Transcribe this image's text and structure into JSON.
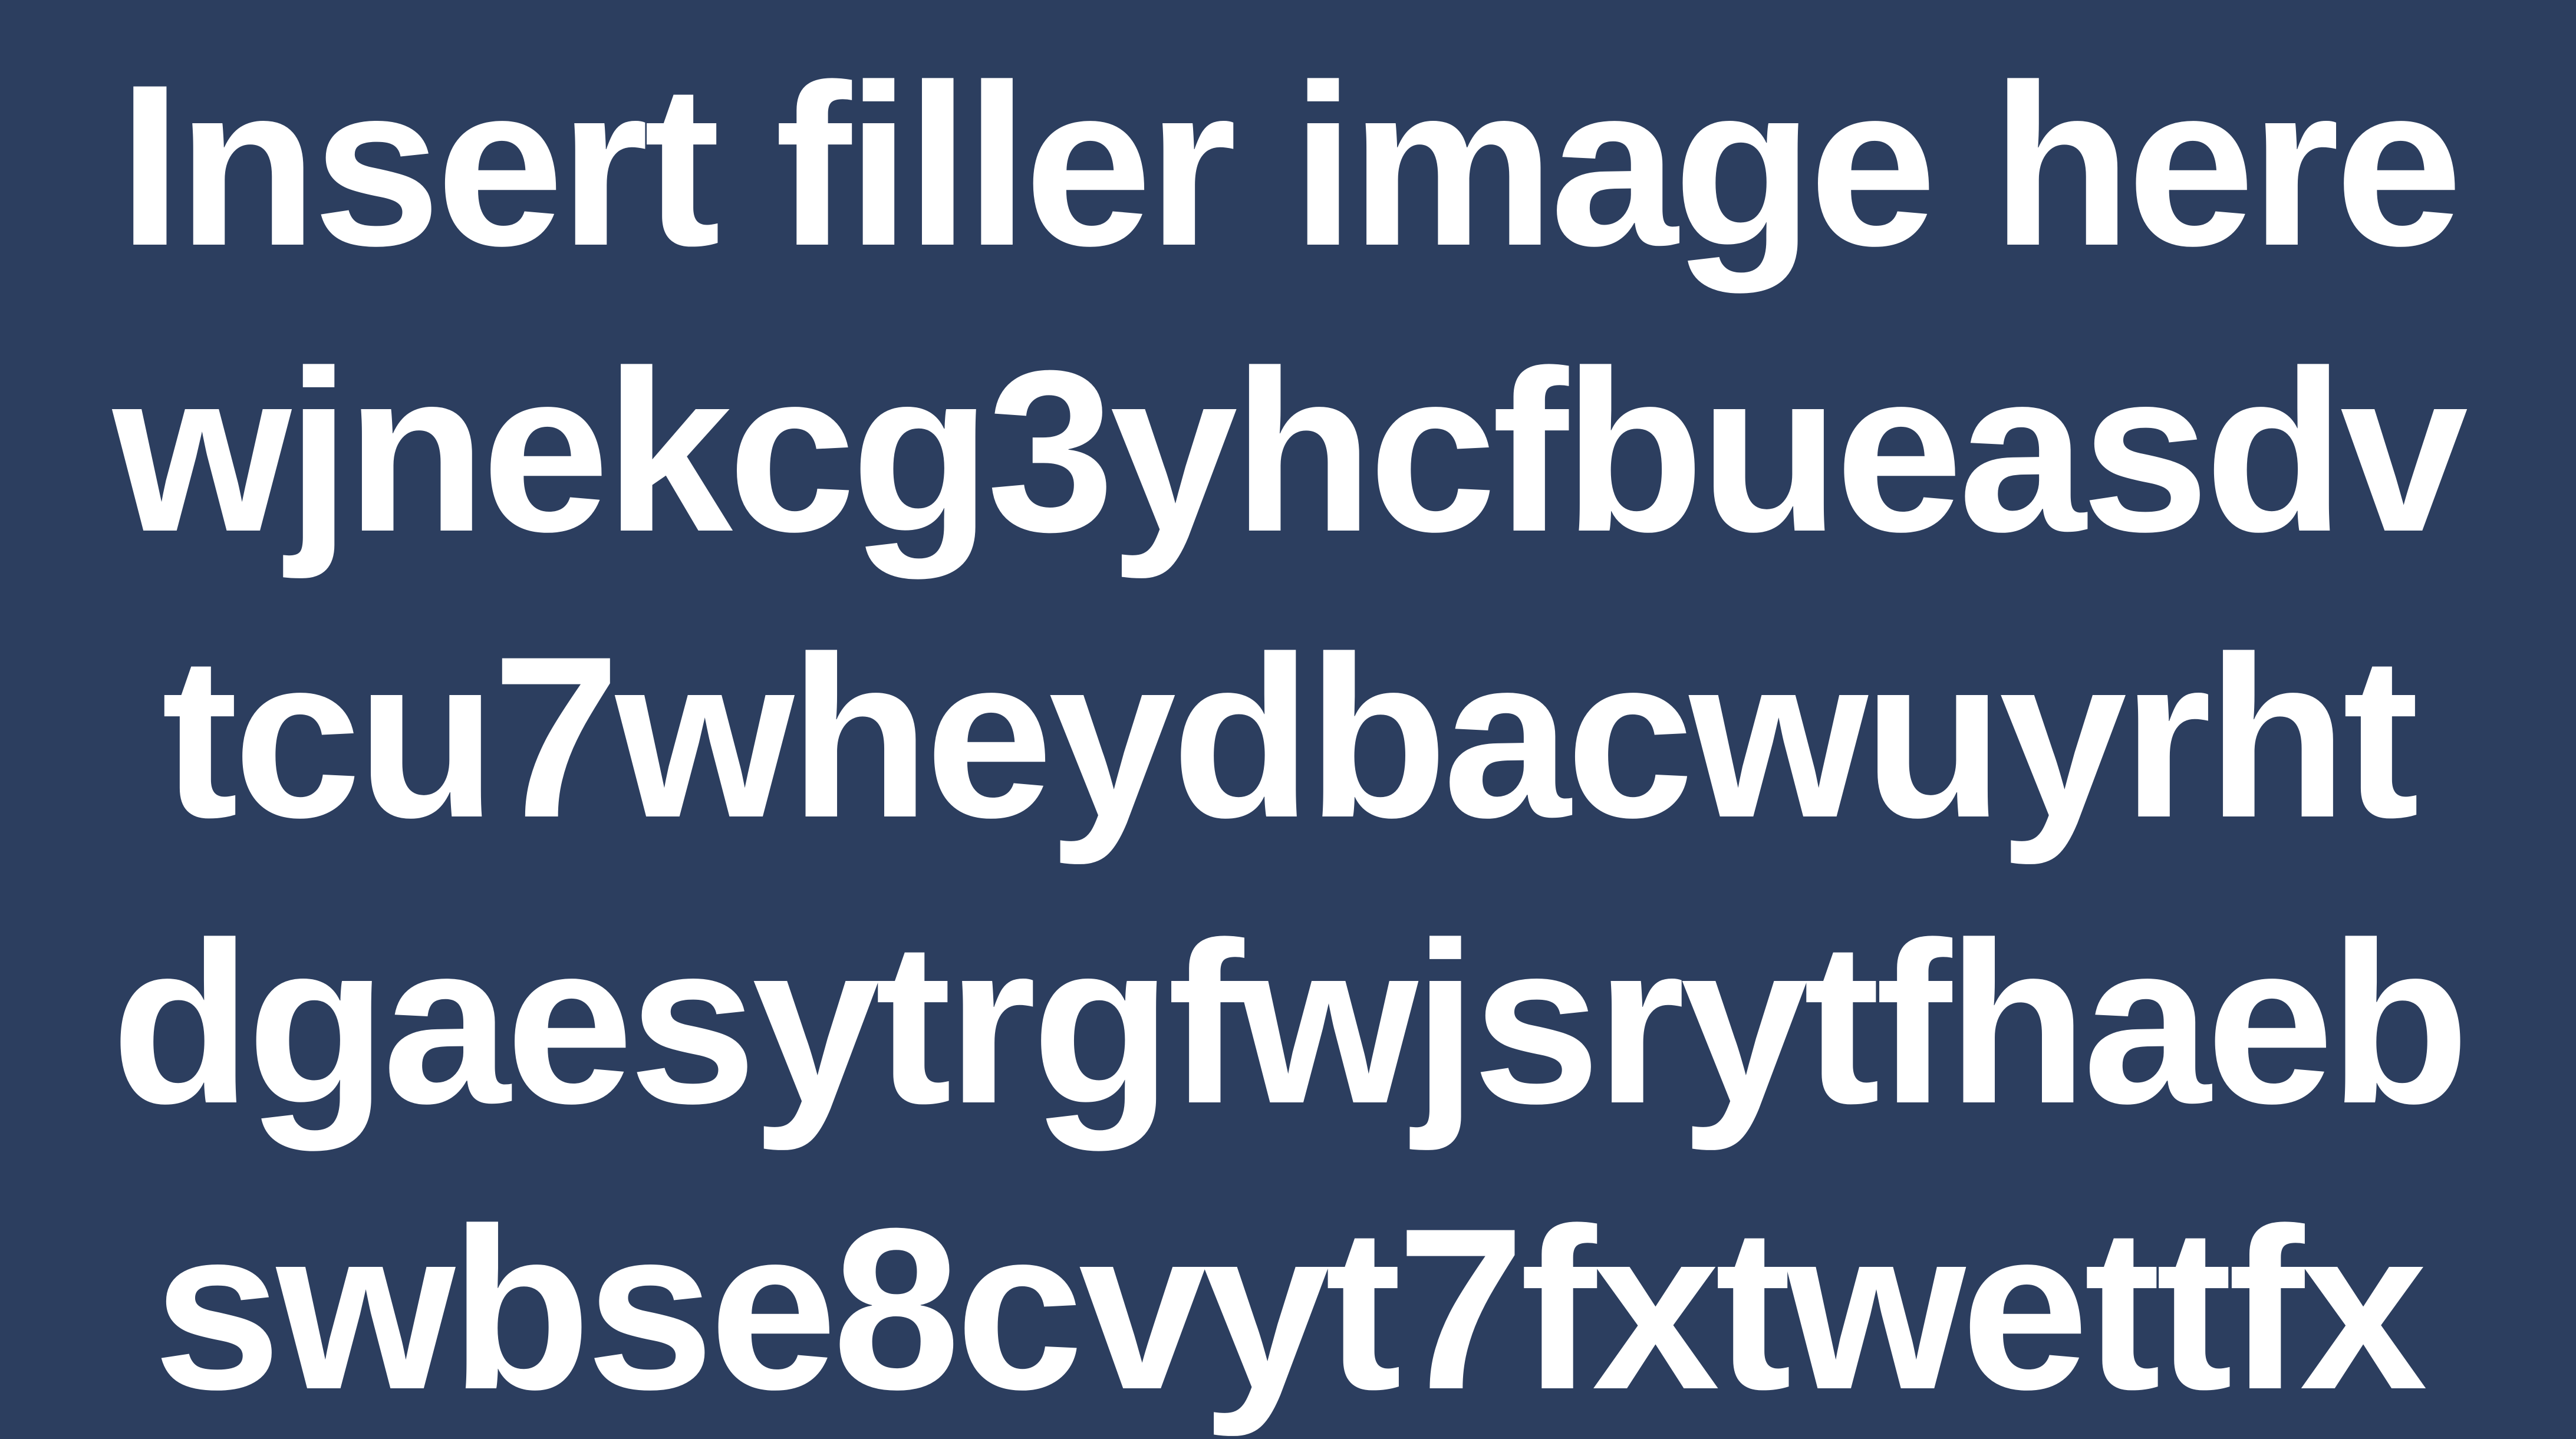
{
  "background_color": "#2c3e5f",
  "text_color": "#ffffff",
  "lines": [
    "Insert filler image here",
    "wjnekcg3yhcfbueasdv",
    "tcu7wheydbacwuyrht",
    "dgaesytrgfwjsrytfhaeb",
    "swbse8cvyt7fxtwettfx"
  ]
}
